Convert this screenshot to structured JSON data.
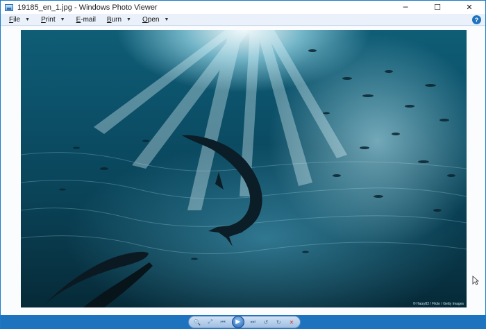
{
  "window": {
    "title": "19185_en_1.jpg - Windows Photo Viewer",
    "controls": {
      "minimize": "─",
      "maximize": "☐",
      "close": "✕"
    }
  },
  "menu": {
    "file": {
      "accel": "F",
      "rest": "ile"
    },
    "print": {
      "accel": "P",
      "rest": "rint"
    },
    "email": {
      "accel": "E",
      "rest": "-mail"
    },
    "burn": {
      "accel": "B",
      "rest": "urn"
    },
    "open": {
      "accel": "O",
      "rest": "pen"
    },
    "help": "?"
  },
  "photo": {
    "credit": "© Haizy82 / Flickr / Getty Images"
  },
  "toolbar": {
    "zoom": "🔍",
    "actual_size": "⤢",
    "previous": "⏮",
    "slideshow": "▶",
    "next": "⏭",
    "rotate_ccw": "↺",
    "rotate_cw": "↻",
    "delete": "✕"
  },
  "colors": {
    "frame": "#1e73be",
    "menu_bg": "#eaf1fa",
    "viewer_bg": "#fbfcfe"
  }
}
